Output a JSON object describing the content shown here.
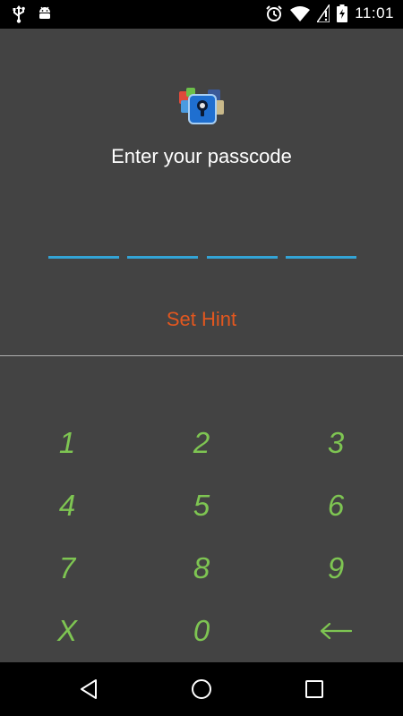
{
  "status_bar": {
    "time": "11:01",
    "left_icons": [
      "usb-icon",
      "android-debug-icon"
    ],
    "right_icons": [
      "alarm-icon",
      "wifi-icon",
      "no-sim-icon",
      "battery-charging-icon"
    ]
  },
  "lock_screen": {
    "app_icon": "passcode-lock-app-icon",
    "prompt": "Enter your passcode",
    "pin_slots": 4,
    "hint_label": "Set Hint"
  },
  "keypad": {
    "keys": [
      "1",
      "2",
      "3",
      "4",
      "5",
      "6",
      "7",
      "8",
      "9",
      "X",
      "0",
      "←"
    ]
  },
  "nav_bar": {
    "buttons": [
      "back-icon",
      "home-icon",
      "recents-icon"
    ]
  },
  "colors": {
    "background": "#434343",
    "pin_slot": "#33a4d6",
    "hint": "#e2571f",
    "keypad_text": "#7ec552"
  }
}
